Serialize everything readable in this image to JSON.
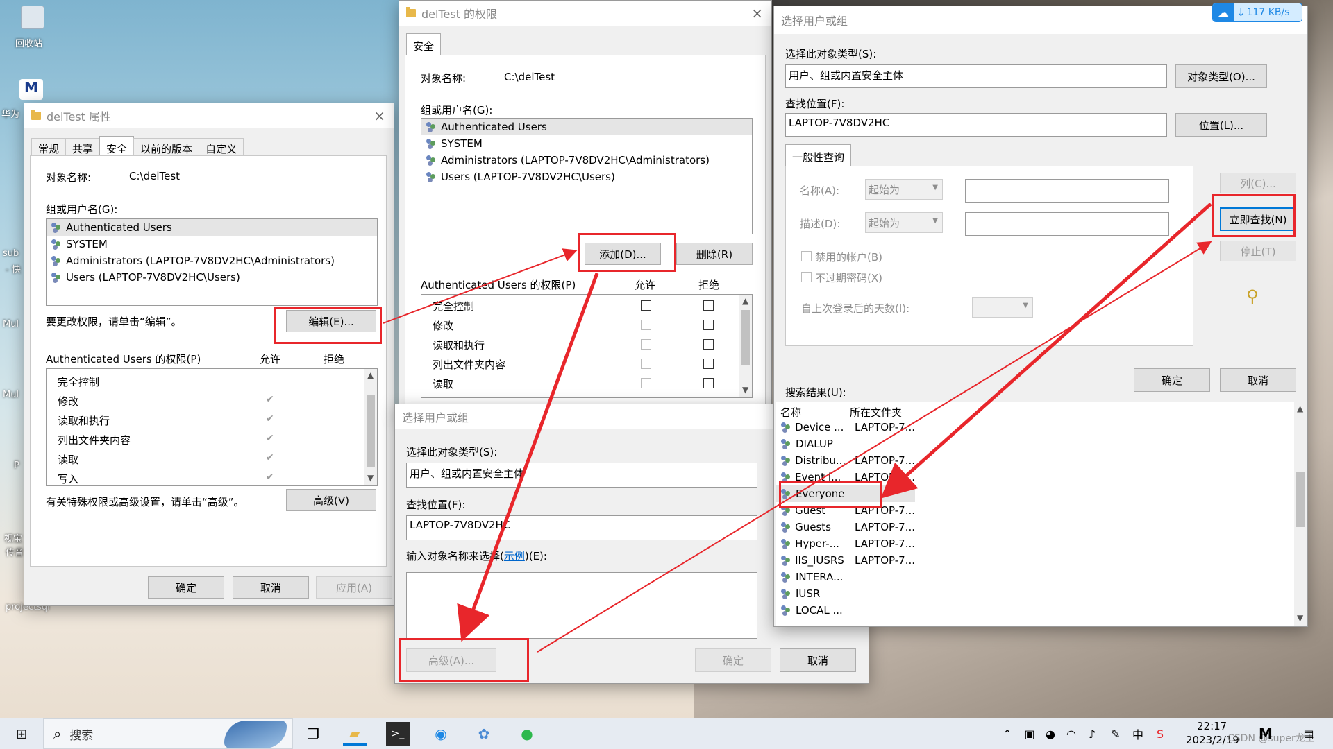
{
  "desktop": {
    "recycle": "回收站",
    "hw": "华为",
    "sub": "sub",
    "sub2": "- 快",
    "mu1": "Mul",
    "mu2": "Mul",
    "p": "P",
    "view1": "视宝",
    "view2": "传音",
    "proj": "projectsql"
  },
  "props": {
    "title": "delTest 属性",
    "tabs": [
      "常规",
      "共享",
      "安全",
      "以前的版本",
      "自定义"
    ],
    "obj_label": "对象名称:",
    "obj_value": "C:\\delTest",
    "group_label": "组或用户名(G):",
    "users": [
      "Authenticated Users",
      "SYSTEM",
      "Administrators (LAPTOP-7V8DV2HC\\Administrators)",
      "Users (LAPTOP-7V8DV2HC\\Users)"
    ],
    "edit_hint": "要更改权限，请单击“编辑”。",
    "edit_btn": "编辑(E)...",
    "perm_label": "Authenticated Users 的权限(P)",
    "allow": "允许",
    "deny": "拒绝",
    "perms": [
      "完全控制",
      "修改",
      "读取和执行",
      "列出文件夹内容",
      "读取",
      "写入"
    ],
    "adv_hint": "有关特殊权限或高级设置，请单击“高级”。",
    "adv_btn": "高级(V)",
    "ok": "确定",
    "cancel": "取消",
    "apply": "应用(A)"
  },
  "perm": {
    "title": "delTest 的权限",
    "tab": "安全",
    "obj_label": "对象名称:",
    "obj_value": "C:\\delTest",
    "group_label": "组或用户名(G):",
    "users": [
      "Authenticated Users",
      "SYSTEM",
      "Administrators (LAPTOP-7V8DV2HC\\Administrators)",
      "Users (LAPTOP-7V8DV2HC\\Users)"
    ],
    "add_btn": "添加(D)...",
    "remove_btn": "删除(R)",
    "perm_label": "Authenticated Users 的权限(P)",
    "allow": "允许",
    "deny": "拒绝",
    "perms": [
      "完全控制",
      "修改",
      "读取和执行",
      "列出文件夹内容",
      "读取"
    ]
  },
  "sel1": {
    "title": "选择用户或组",
    "type_label": "选择此对象类型(S):",
    "type_value": "用户、组或内置安全主体",
    "loc_label": "查找位置(F):",
    "loc_value": "LAPTOP-7V8DV2HC",
    "enter_label_a": "输入对象名称来选择(",
    "enter_link": "示例",
    "enter_label_b": ")(E):",
    "adv_btn": "高级(A)...",
    "ok": "确定",
    "cancel": "取消"
  },
  "sel2": {
    "title": "选择用户或组",
    "type_label": "选择此对象类型(S):",
    "type_value": "用户、组或内置安全主体",
    "type_btn": "对象类型(O)...",
    "loc_label": "查找位置(F):",
    "loc_value": "LAPTOP-7V8DV2HC",
    "loc_btn": "位置(L)...",
    "tab": "一般性查询",
    "name_label": "名称(A):",
    "desc_label": "描述(D):",
    "starts": "起始为",
    "col_btn": "列(C)...",
    "find_btn": "立即查找(N)",
    "stop_btn": "停止(T)",
    "disabled_chk": "禁用的帐户(B)",
    "noexp_chk": "不过期密码(X)",
    "days_label": "自上次登录后的天数(I):",
    "ok": "确定",
    "cancel": "取消",
    "results_label": "搜索结果(U):",
    "col_name": "名称",
    "col_folder": "所在文件夹",
    "results": [
      {
        "name": "Device ...",
        "folder": "LAPTOP-7..."
      },
      {
        "name": "DIALUP",
        "folder": ""
      },
      {
        "name": "Distribu...",
        "folder": "LAPTOP-7..."
      },
      {
        "name": "Event l...",
        "folder": "LAPTOP-7..."
      },
      {
        "name": "Everyone",
        "folder": ""
      },
      {
        "name": "Guest",
        "folder": "LAPTOP-7..."
      },
      {
        "name": "Guests",
        "folder": "LAPTOP-7..."
      },
      {
        "name": "Hyper-...",
        "folder": "LAPTOP-7..."
      },
      {
        "name": "IIS_IUSRS",
        "folder": "LAPTOP-7..."
      },
      {
        "name": "INTERA...",
        "folder": ""
      },
      {
        "name": "IUSR",
        "folder": ""
      },
      {
        "name": "LOCAL ...",
        "folder": ""
      }
    ]
  },
  "net": {
    "speed": "117 KB/s"
  },
  "taskbar": {
    "search": "搜索",
    "time": "22:17",
    "date": "2023/2/19",
    "watermark": "CSDN @super龙王"
  },
  "colors": {
    "highlight": "#e8262b",
    "accent": "#0078d7"
  }
}
